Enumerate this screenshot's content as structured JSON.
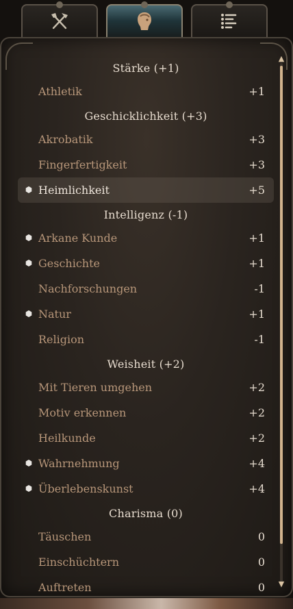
{
  "tabs": [
    {
      "icon": "crossed-tools-icon",
      "label": "Tools"
    },
    {
      "icon": "character-head-icon",
      "label": "Character"
    },
    {
      "icon": "list-icon",
      "label": "List"
    }
  ],
  "active_tab": 1,
  "colors": {
    "header": "#e8ddd0",
    "skill": "#b8977a",
    "value": "#e6dccf",
    "highlight_bg": "#5d544b",
    "scroll_thumb": "#d2b48e"
  },
  "groups": [
    {
      "header": "Stärke (+1)",
      "skills": [
        {
          "name": "Athletik",
          "value": "+1",
          "proficient": false,
          "highlight": false
        }
      ]
    },
    {
      "header": "Geschicklichkeit (+3)",
      "skills": [
        {
          "name": "Akrobatik",
          "value": "+3",
          "proficient": false,
          "highlight": false
        },
        {
          "name": "Fingerfertigkeit",
          "value": "+3",
          "proficient": false,
          "highlight": false
        },
        {
          "name": "Heimlichkeit",
          "value": "+5",
          "proficient": true,
          "highlight": true
        }
      ]
    },
    {
      "header": "Intelligenz (-1)",
      "skills": [
        {
          "name": "Arkane Kunde",
          "value": "+1",
          "proficient": true,
          "highlight": false
        },
        {
          "name": "Geschichte",
          "value": "+1",
          "proficient": true,
          "highlight": false
        },
        {
          "name": "Nachforschungen",
          "value": "-1",
          "proficient": false,
          "highlight": false
        },
        {
          "name": "Natur",
          "value": "+1",
          "proficient": true,
          "highlight": false
        },
        {
          "name": "Religion",
          "value": "-1",
          "proficient": false,
          "highlight": false
        }
      ]
    },
    {
      "header": "Weisheit (+2)",
      "skills": [
        {
          "name": "Mit Tieren umgehen",
          "value": "+2",
          "proficient": false,
          "highlight": false
        },
        {
          "name": "Motiv erkennen",
          "value": "+2",
          "proficient": false,
          "highlight": false
        },
        {
          "name": "Heilkunde",
          "value": "+2",
          "proficient": false,
          "highlight": false
        },
        {
          "name": "Wahrnehmung",
          "value": "+4",
          "proficient": true,
          "highlight": false
        },
        {
          "name": "Überlebenskunst",
          "value": "+4",
          "proficient": true,
          "highlight": false
        }
      ]
    },
    {
      "header": "Charisma (0)",
      "skills": [
        {
          "name": "Täuschen",
          "value": "0",
          "proficient": false,
          "highlight": false
        },
        {
          "name": "Einschüchtern",
          "value": "0",
          "proficient": false,
          "highlight": false
        },
        {
          "name": "Auftreten",
          "value": "0",
          "proficient": false,
          "highlight": false
        }
      ]
    }
  ],
  "scrollbar": {
    "up_icon": "scroll-up-arrow-icon",
    "down_icon": "scroll-down-arrow-icon",
    "position": 0.0
  }
}
